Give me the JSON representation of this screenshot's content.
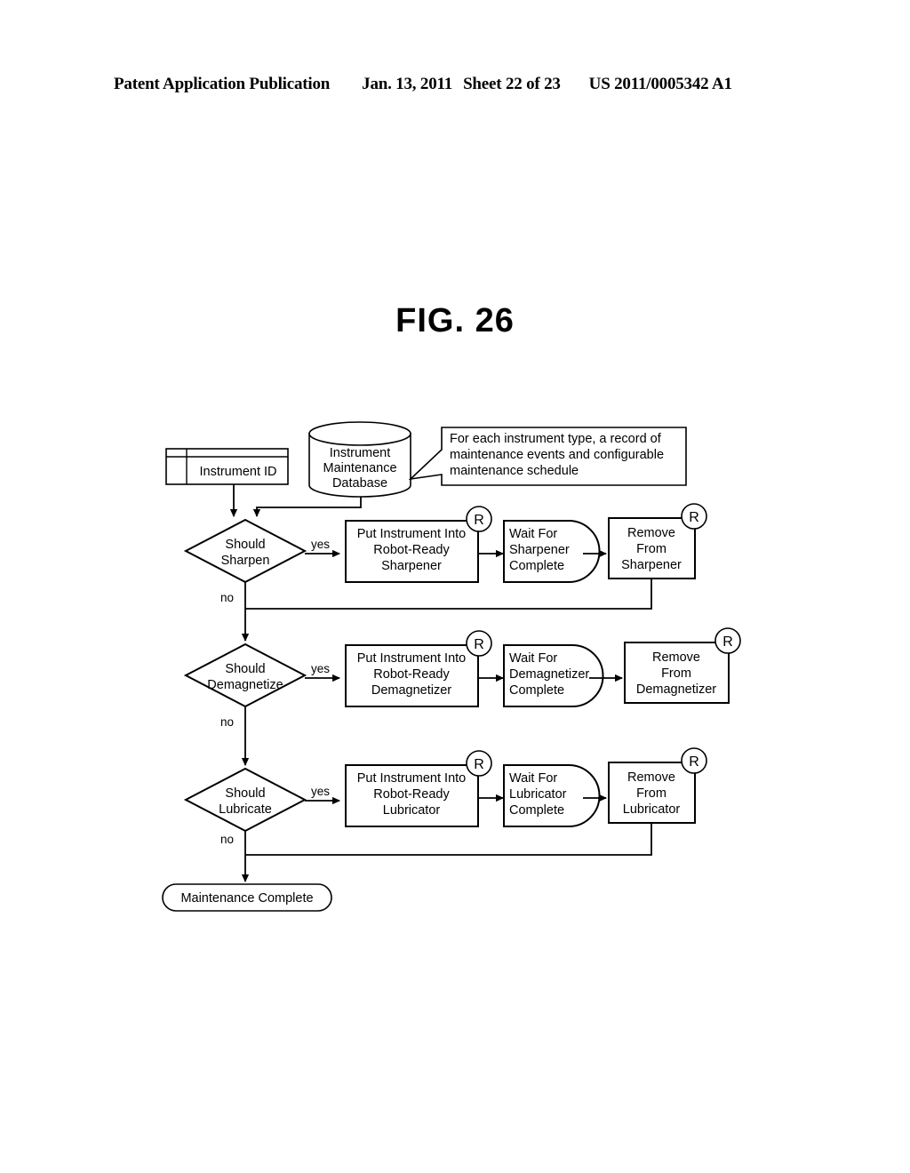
{
  "header": {
    "publication": "Patent Application Publication",
    "date": "Jan. 13, 2011",
    "sheet": "Sheet 22 of 23",
    "number": "US 2011/0005342 A1"
  },
  "figure": {
    "title": "FIG. 26"
  },
  "diagram": {
    "type": "flowchart",
    "input_node": {
      "shape": "predefined-process",
      "label": "Instrument ID"
    },
    "database_node": {
      "shape": "cylinder",
      "line1": "Instrument",
      "line2": "Maintenance",
      "line3": "Database"
    },
    "callout": {
      "shape": "note-box",
      "line1": "For each instrument type, a record of",
      "line2": "maintenance events and configurable",
      "line3": "maintenance schedule"
    },
    "branch_labels": {
      "yes": "yes",
      "no": "no"
    },
    "robot_badge": "R",
    "rows": [
      {
        "decision_line1": "Should",
        "decision_line2": "Sharpen",
        "put_line1": "Put Instrument Into",
        "put_line2": "Robot-Ready",
        "put_line3": "Sharpener",
        "wait_line1": "Wait For",
        "wait_line2": "Sharpener",
        "wait_line3": "Complete",
        "remove_line1": "Remove",
        "remove_line2": "From",
        "remove_line3": "Sharpener"
      },
      {
        "decision_line1": "Should",
        "decision_line2": "Demagnetize",
        "put_line1": "Put Instrument Into",
        "put_line2": "Robot-Ready",
        "put_line3": "Demagnetizer",
        "wait_line1": "Wait For",
        "wait_line2": "Demagnetizer",
        "wait_line3": "Complete",
        "remove_line1": "Remove",
        "remove_line2": "From",
        "remove_line3": "Demagnetizer"
      },
      {
        "decision_line1": "Should",
        "decision_line2": "Lubricate",
        "put_line1": "Put Instrument Into",
        "put_line2": "Robot-Ready",
        "put_line3": "Lubricator",
        "wait_line1": "Wait For",
        "wait_line2": "Lubricator",
        "wait_line3": "Complete",
        "remove_line1": "Remove",
        "remove_line2": "From",
        "remove_line3": "Lubricator"
      }
    ],
    "terminal_node": {
      "shape": "stadium",
      "label": "Maintenance Complete"
    }
  }
}
